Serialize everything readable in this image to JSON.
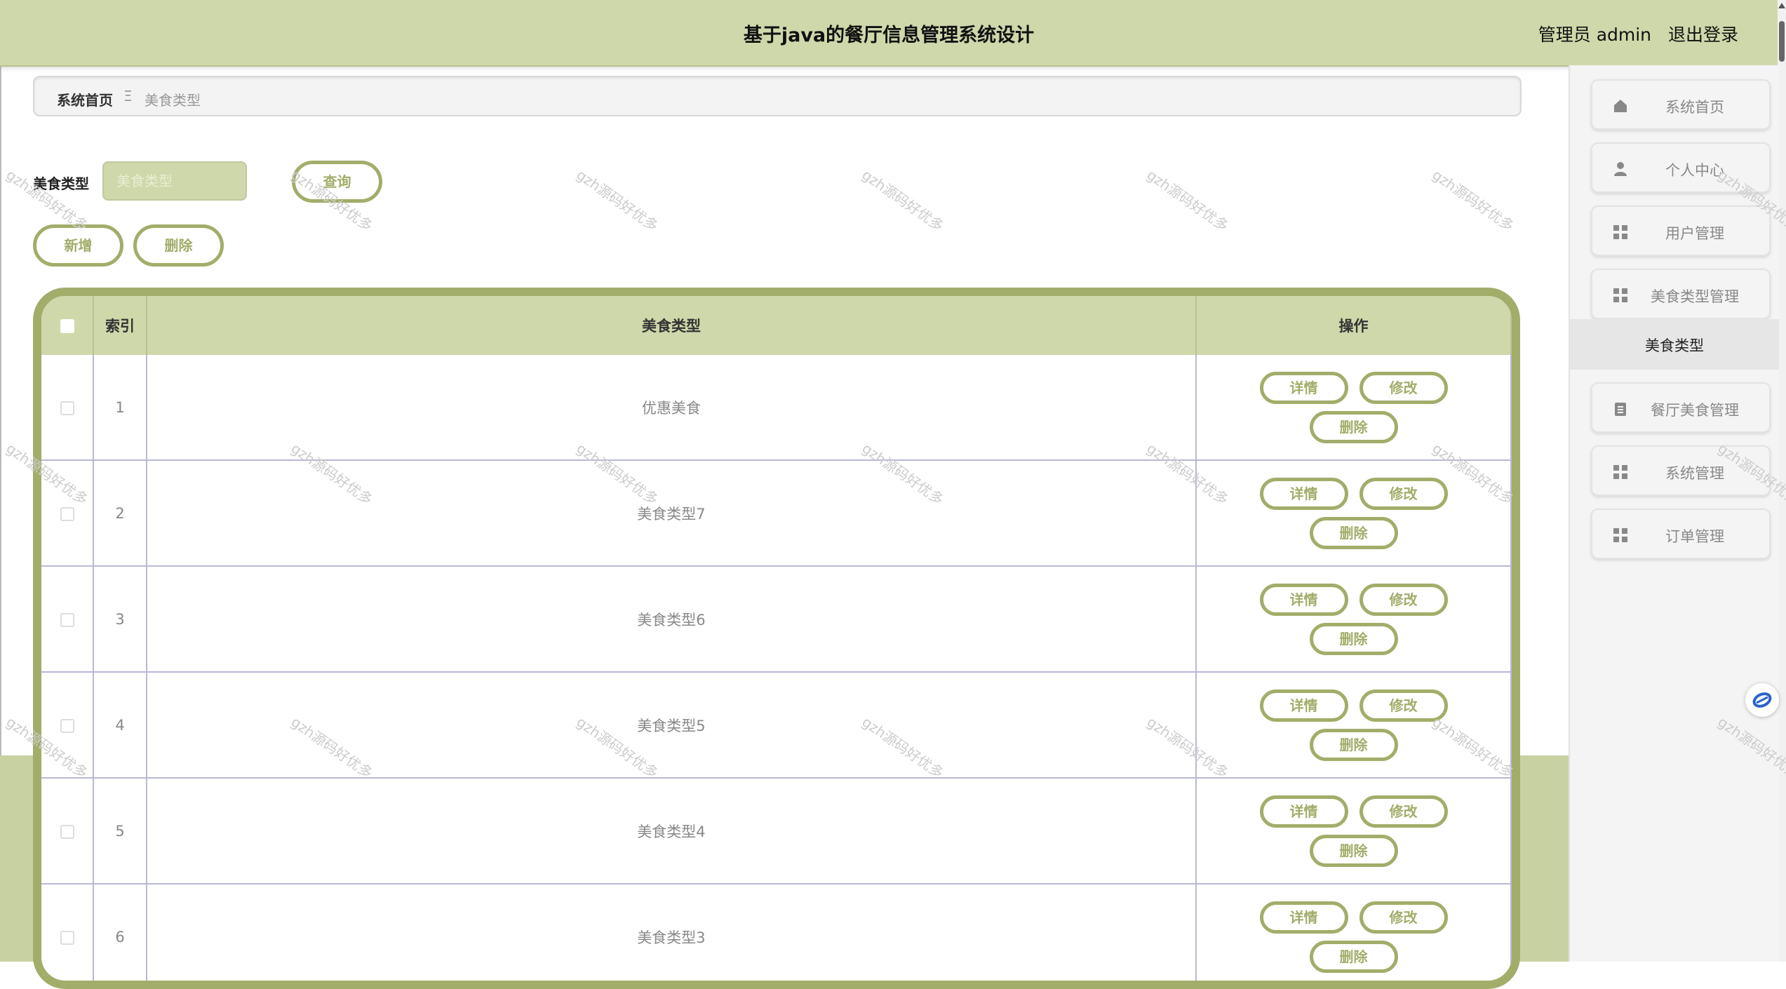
{
  "header": {
    "title": "基于java的餐厅信息管理系统设计",
    "user_label": "管理员 admin",
    "logout": "退出登录"
  },
  "breadcrumb": {
    "home": "系统首页",
    "separator": "Ξ",
    "current": "美食类型"
  },
  "search": {
    "label": "美食类型",
    "placeholder": "美食类型",
    "value": "",
    "button": "查询"
  },
  "actions": {
    "add": "新增",
    "delete": "删除"
  },
  "table": {
    "headers": {
      "index": "索引",
      "type": "美食类型",
      "ops": "操作"
    },
    "op_labels": {
      "detail": "详情",
      "edit": "修改",
      "delete": "删除"
    },
    "rows": [
      {
        "index": "1",
        "type": "优惠美食"
      },
      {
        "index": "2",
        "type": "美食类型7"
      },
      {
        "index": "3",
        "type": "美食类型6"
      },
      {
        "index": "4",
        "type": "美食类型5"
      },
      {
        "index": "5",
        "type": "美食类型4"
      },
      {
        "index": "6",
        "type": "美食类型3"
      }
    ]
  },
  "sidebar": {
    "items": [
      {
        "label": "系统首页",
        "icon": "home-icon"
      },
      {
        "label": "个人中心",
        "icon": "user-icon"
      },
      {
        "label": "用户管理",
        "icon": "grid-icon"
      },
      {
        "label": "美食类型管理",
        "icon": "grid-icon"
      },
      {
        "label": "餐厅美食管理",
        "icon": "clipboard-icon"
      },
      {
        "label": "系统管理",
        "icon": "grid-icon"
      },
      {
        "label": "订单管理",
        "icon": "grid-icon"
      }
    ],
    "active_sub": "美食类型"
  },
  "watermark": "gzh源码好优多",
  "colors": {
    "header_bg": "#cfd8aa",
    "accent": "#a2ad6a",
    "sidebar_bg": "#f4f4f4"
  }
}
